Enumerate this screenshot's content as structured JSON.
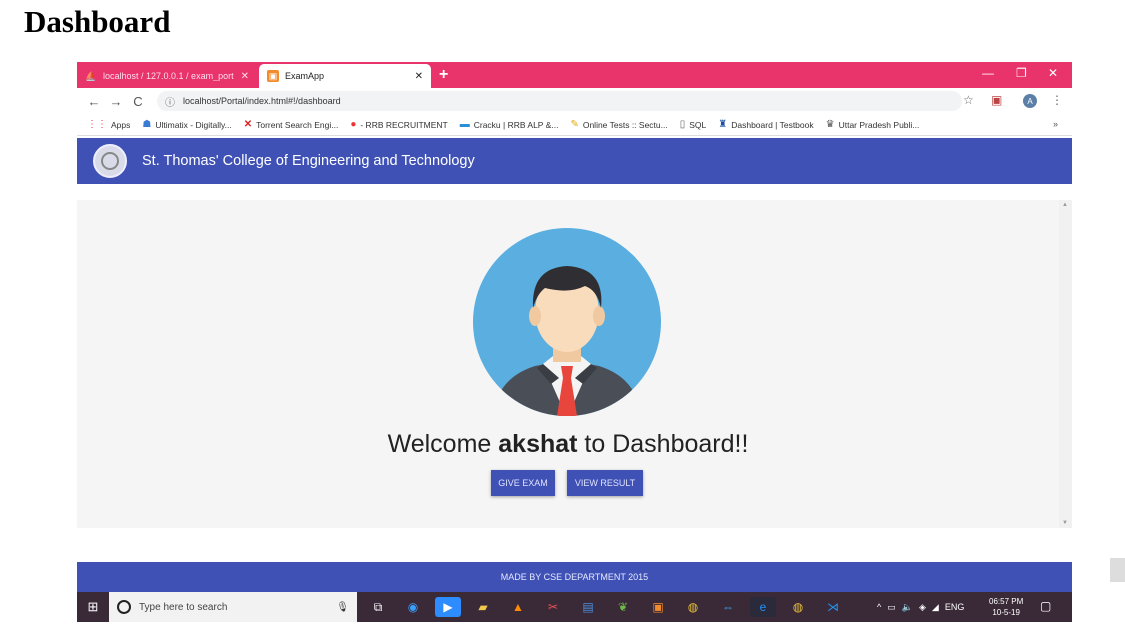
{
  "page_heading": "Dashboard",
  "browser": {
    "tabs": [
      {
        "title": "localhost / 127.0.0.1 / exam_port",
        "icon": "phpmyadmin-icon"
      },
      {
        "title": "ExamApp",
        "icon": "examapp-icon"
      }
    ],
    "url": "localhost/Portal/index.html#!/dashboard",
    "bookmarks": [
      {
        "label": "Apps",
        "icon": "apps-grid-icon"
      },
      {
        "label": "Ultimatix - Digitally...",
        "icon": "ultimatix-icon"
      },
      {
        "label": "Torrent Search Engi...",
        "icon": "torrent-icon"
      },
      {
        "label": "- RRB RECRUITMENT",
        "icon": "rrb-icon"
      },
      {
        "label": "Cracku | RRB ALP &...",
        "icon": "cracku-icon"
      },
      {
        "label": "Online Tests :: Sectu...",
        "icon": "online-tests-icon"
      },
      {
        "label": "SQL",
        "icon": "page-icon"
      },
      {
        "label": "Dashboard | Testbook",
        "icon": "testbook-icon"
      },
      {
        "label": "Uttar Pradesh Publi...",
        "icon": "up-emblem-icon"
      }
    ],
    "profile_initial": "A"
  },
  "app": {
    "college_name": "St. Thomas' College of Engineering and Technology",
    "welcome_prefix": "Welcome ",
    "username": "akshat",
    "welcome_suffix": " to Dashboard!!",
    "give_exam_label": "GIVE EXAM",
    "view_result_label": "VIEW RESULT",
    "footer_text": "MADE BY CSE DEPARTMENT 2015",
    "accent_color": "#3f51b5"
  },
  "taskbar": {
    "search_placeholder": "Type here to search",
    "language": "ENG",
    "time": "06:57 PM",
    "date": "10-5-19"
  }
}
